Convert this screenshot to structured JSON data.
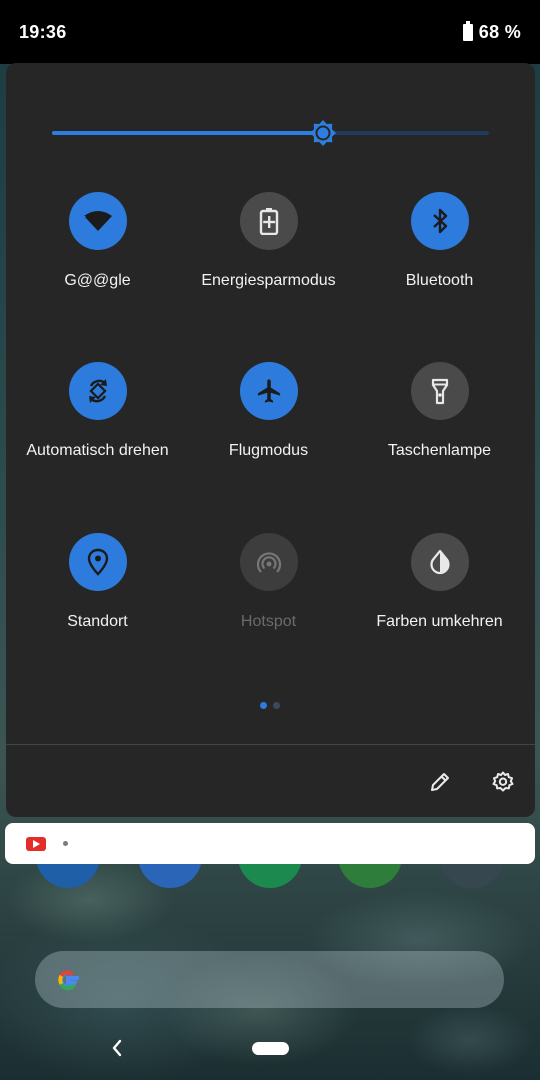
{
  "status_bar": {
    "time": "19:36",
    "battery_percent": "68 %",
    "battery_level": 0.68
  },
  "brightness": {
    "level": 0.62,
    "accent": "#2e7de0"
  },
  "tiles": [
    {
      "label": "G@@gle",
      "icon": "wifi-icon",
      "state": "on"
    },
    {
      "label": "Energiesparmodus",
      "icon": "battery-saver-icon",
      "state": "off"
    },
    {
      "label": "Bluetooth",
      "icon": "bluetooth-icon",
      "state": "on"
    },
    {
      "label": "Automatisch drehen",
      "icon": "auto-rotate-icon",
      "state": "on"
    },
    {
      "label": "Flugmodus",
      "icon": "airplane-icon",
      "state": "on"
    },
    {
      "label": "Taschenlampe",
      "icon": "flashlight-icon",
      "state": "off"
    },
    {
      "label": "Standort",
      "icon": "location-icon",
      "state": "on"
    },
    {
      "label": "Hotspot",
      "icon": "hotspot-icon",
      "state": "disabled"
    },
    {
      "label": "Farben umkehren",
      "icon": "invert-colors-icon",
      "state": "off"
    }
  ],
  "pagination": {
    "pages": 2,
    "current": 1,
    "active_color": "#2d7bdc",
    "inactive_color": "#3a4a5e"
  },
  "footer": {
    "edit_icon": "pencil-icon",
    "settings_icon": "gear-icon"
  },
  "notification": {
    "app_icon": "youtube-icon",
    "app_color": "#e52d27"
  },
  "search": {
    "icon": "google-g-icon"
  },
  "nav": {
    "back_icon": "back-chevron-icon",
    "home_icon": "home-pill-icon"
  }
}
